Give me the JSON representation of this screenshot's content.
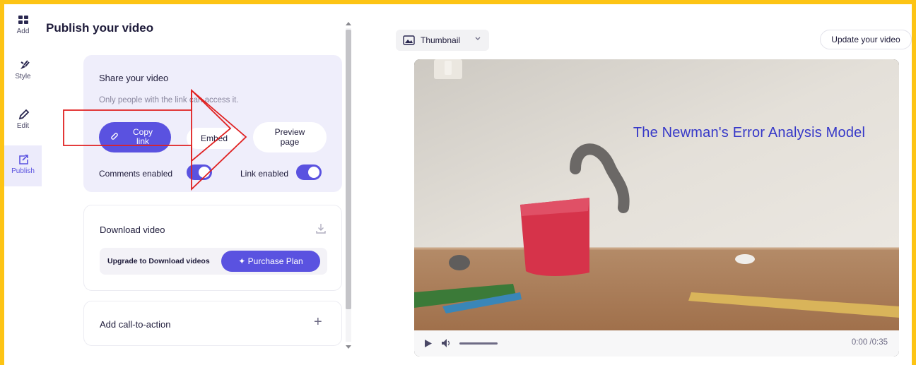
{
  "nav": {
    "items": [
      {
        "label": "Add",
        "icon": "grid-icon"
      },
      {
        "label": "Style",
        "icon": "paint-brush-icon"
      },
      {
        "label": "Edit",
        "icon": "pencil-icon"
      },
      {
        "label": "Publish",
        "icon": "share-box-icon",
        "active": true
      }
    ]
  },
  "panel": {
    "title": "Publish your video",
    "share": {
      "title": "Share your video",
      "subtitle": "Only people with the link can access it.",
      "copy_label": "Copy link",
      "embed_label": "Embed",
      "preview_label": "Preview page",
      "comments_label": "Comments enabled",
      "comments_enabled": true,
      "link_label": "Link enabled",
      "link_enabled": true
    },
    "download": {
      "title": "Download video",
      "upgrade_text": "Upgrade to Download videos",
      "purchase_label": "Purchase Plan"
    },
    "cta": {
      "title": "Add call-to-action",
      "plus": "+"
    }
  },
  "preview": {
    "thumbnail_label": "Thumbnail",
    "update_label": "Update your video",
    "video_title": "The Newman's Error Analysis Model",
    "time": "0:00 /0:35"
  },
  "colors": {
    "accent": "#5a52e0",
    "frame": "#fdc414",
    "annotation": "#e02020",
    "video_title": "#3537c8"
  }
}
